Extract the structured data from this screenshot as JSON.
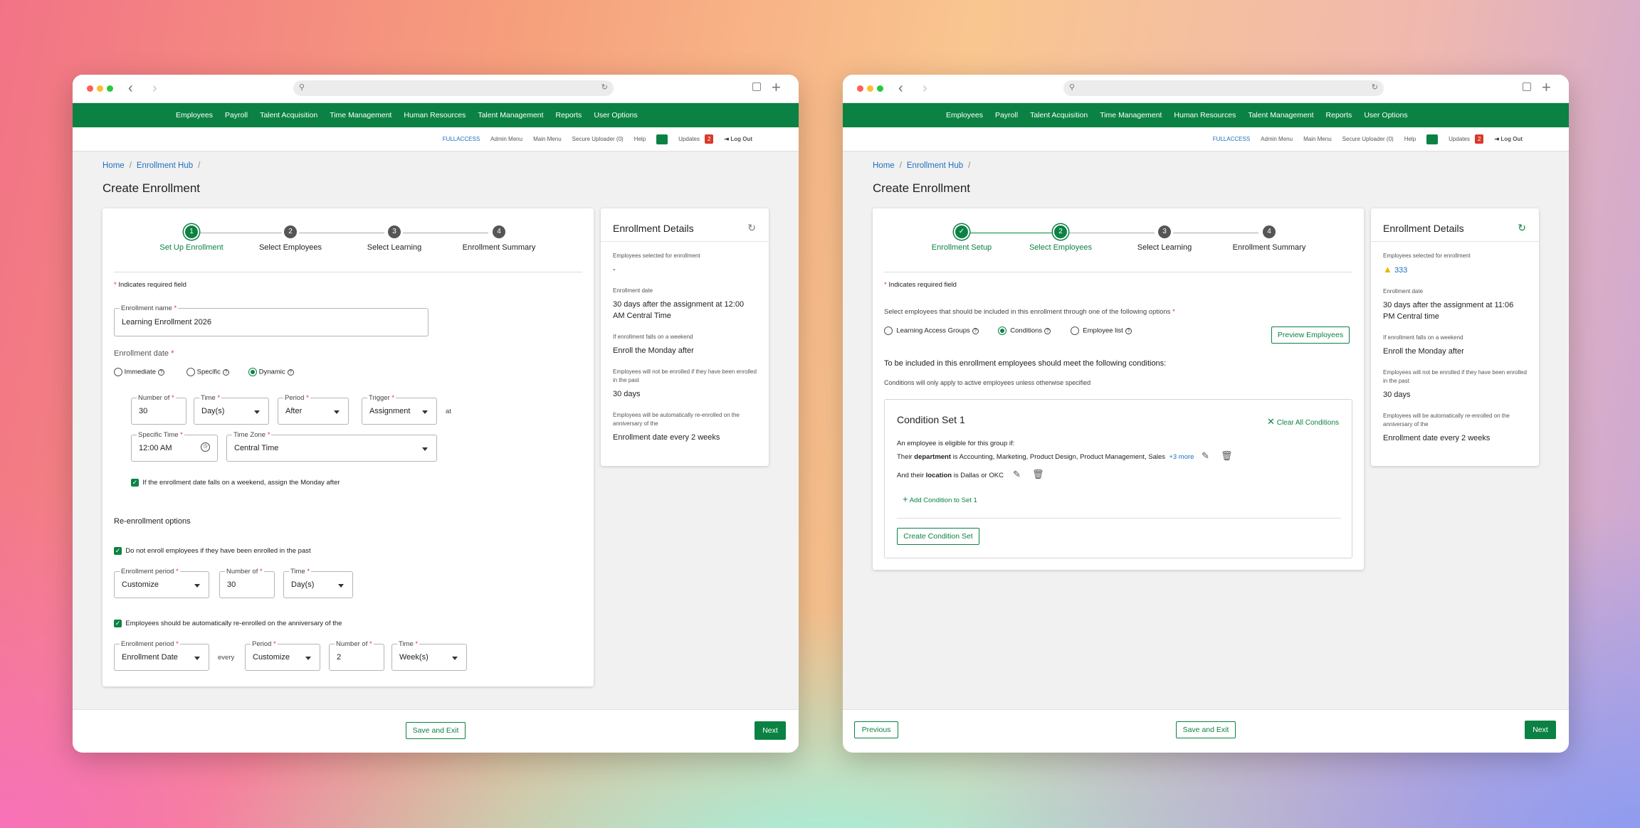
{
  "nav": [
    "Employees",
    "Payroll",
    "Talent Acquisition",
    "Time Management",
    "Human Resources",
    "Talent Management",
    "Reports",
    "User Options"
  ],
  "util": {
    "fullaccess": "FULLACCESS",
    "admin": "Admin Menu",
    "main": "Main Menu",
    "uploader": "Secure Uploader (0)",
    "help": "Help",
    "updates": "Updates",
    "updates_count": "2",
    "logout": "Log Out"
  },
  "breadcrumb": {
    "home": "Home",
    "hub": "Enrollment Hub",
    "sep": "/"
  },
  "page_title": "Create Enrollment",
  "colors": {
    "brand_green": "#0b8243",
    "link_blue": "#1e6fbd",
    "alert_red": "#d9392b"
  },
  "w1": {
    "steps": [
      "Set Up Enrollment",
      "Select Employees",
      "Select Learning",
      "Enrollment Summary"
    ],
    "step_nums": [
      "1",
      "2",
      "3",
      "4"
    ],
    "required_note": "Indicates required field",
    "enrollment_name": {
      "label": "Enrollment name",
      "value": "Learning Enrollment 2026"
    },
    "enrollment_date_label": "Enrollment date",
    "date_options": [
      "Immediate",
      "Specific",
      "Dynamic"
    ],
    "number_of": {
      "label": "Number of",
      "value": "30"
    },
    "time": {
      "label": "Time",
      "value": "Day(s)"
    },
    "period": {
      "label": "Period",
      "value": "After"
    },
    "trigger": {
      "label": "Trigger",
      "value": "Assignment"
    },
    "at": "at",
    "specific_time": {
      "label": "Specific Time",
      "value": "12:00 AM"
    },
    "time_zone": {
      "label": "Time Zone",
      "value": "Central Time"
    },
    "weekend_check": "If the enrollment date falls on a weekend, assign the Monday after",
    "reenroll_title": "Re-enrollment options",
    "no_enroll_check": "Do not enroll employees if they have been enrolled in the past",
    "enroll_period": {
      "label": "Enrollment period",
      "value": "Customize"
    },
    "number_of2": {
      "label": "Number of",
      "value": "30"
    },
    "time2": {
      "label": "Time",
      "value": "Day(s)"
    },
    "auto_check": "Employees should be automatically re-enrolled on the anniversary of the",
    "enroll_period2": {
      "label": "Enrollment period",
      "value": "Enrollment Date"
    },
    "every": "every",
    "period2": {
      "label": "Period",
      "value": "Customize"
    },
    "number_of3": {
      "label": "Number of",
      "value": "2"
    },
    "time3": {
      "label": "Time",
      "value": "Week(s)"
    },
    "save_exit": "Save and Exit",
    "next": "Next",
    "details": {
      "title": "Enrollment Details",
      "k1": "Employees selected for enrollment",
      "v1": "-",
      "k2": "Enrollment date",
      "v2": "30 days after the assignment  at 12:00 AM Central Time",
      "k3": "If enrollment falls on a weekend",
      "v3": "Enroll the Monday after",
      "k4": "Employees will not be enrolled if they have been enrolled in the past",
      "v4": "30 days",
      "k5": "Employees will be automatically re-enrolled on the anniversary of the",
      "v5": "Enrollment date every 2 weeks"
    }
  },
  "w2": {
    "steps": [
      "Enrollment Setup",
      "Select Employees",
      "Select Learning",
      "Enrollment Summary"
    ],
    "step_nums": [
      "✓",
      "2",
      "3",
      "4"
    ],
    "required_note": "Indicates required field",
    "select_prompt": "Select employees that should be included in this enrollment through one of the following options",
    "options": [
      "Learning Access Groups",
      "Conditions",
      "Employee list"
    ],
    "preview": "Preview Employees",
    "conditions_title": "To be included in this enrollment employees should meet the following conditions:",
    "conditions_note": "Conditions will only apply to active employees unless otherwise specified",
    "set_title": "Condition Set 1",
    "clear_all": "Clear All Conditions",
    "eligible": "An employee is eligible for this group if:",
    "c1_pre": "Their",
    "c1_key": "department",
    "c1_rest": "is Accounting, Marketing, Product Design, Product Management, Sales",
    "c1_more": "+3 more",
    "c2_pre": "And their",
    "c2_key": "location",
    "c2_rest": "is Dallas or OKC",
    "add_condition": "Add Condition to Set 1",
    "create_set": "Create Condition Set",
    "previous": "Previous",
    "save_exit": "Save and Exit",
    "next": "Next",
    "details": {
      "title": "Enrollment Details",
      "k1": "Employees selected for enrollment",
      "v1": "333",
      "k2": "Enrollment date",
      "v2": "30 days after the assignment  at 11:06 PM Central time",
      "k3": "If enrollment falls on a weekend",
      "v3": "Enroll the Monday after",
      "k4": "Employees will not be enrolled if they have been enrolled in the past",
      "v4": "30 days",
      "k5": "Employees will be automatically re-enrolled on the anniversary of the",
      "v5": "Enrollment date every 2 weeks"
    }
  }
}
